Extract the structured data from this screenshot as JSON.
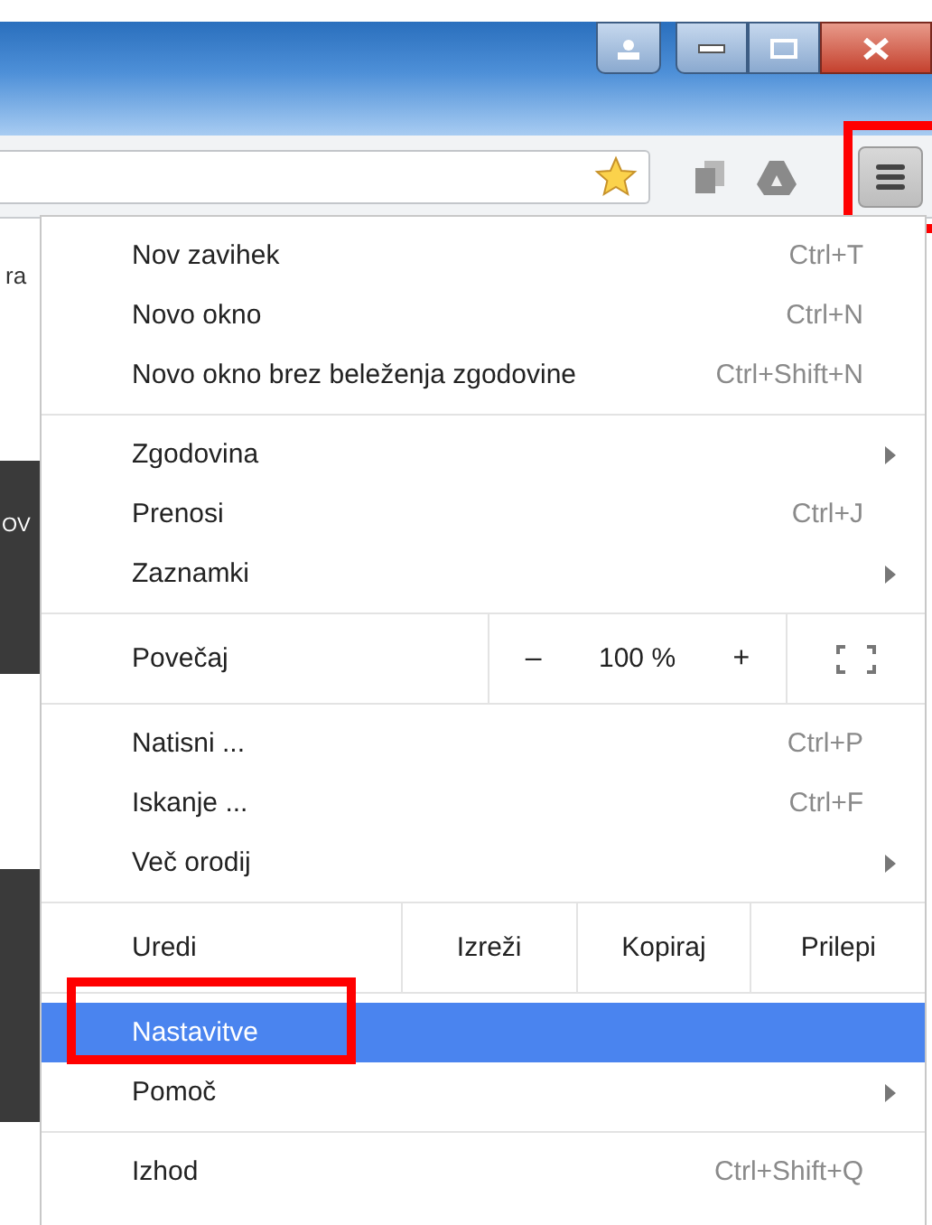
{
  "toolbar": {
    "menu_button": {
      "annotated": true
    }
  },
  "page_fragments": [
    {
      "text": "ra",
      "dark": false
    },
    {
      "text": "OV",
      "dark": true
    }
  ],
  "menu": {
    "groups": [
      {
        "items": [
          {
            "kind": "item",
            "label": "Nov zavihek",
            "shortcut": "Ctrl+T",
            "submenu": false,
            "selected": false,
            "annotated": false
          },
          {
            "kind": "item",
            "label": "Novo okno",
            "shortcut": "Ctrl+N",
            "submenu": false,
            "selected": false,
            "annotated": false
          },
          {
            "kind": "item",
            "label": "Novo okno brez beleženja zgodovine",
            "shortcut": "Ctrl+Shift+N",
            "submenu": false,
            "selected": false,
            "annotated": false
          }
        ]
      },
      {
        "items": [
          {
            "kind": "item",
            "label": "Zgodovina",
            "submenu": true,
            "selected": false,
            "annotated": false
          },
          {
            "kind": "item",
            "label": "Prenosi",
            "shortcut": "Ctrl+J",
            "submenu": false,
            "selected": false,
            "annotated": false
          },
          {
            "kind": "item",
            "label": "Zaznamki",
            "submenu": true,
            "selected": false,
            "annotated": false
          }
        ]
      },
      {
        "items": [
          {
            "kind": "zoom",
            "label": "Povečaj",
            "minus": "–",
            "value": "100 %",
            "plus": "+"
          }
        ]
      },
      {
        "items": [
          {
            "kind": "item",
            "label": "Natisni ...",
            "shortcut": "Ctrl+P",
            "submenu": false,
            "selected": false,
            "annotated": false
          },
          {
            "kind": "item",
            "label": "Iskanje ...",
            "shortcut": "Ctrl+F",
            "submenu": false,
            "selected": false,
            "annotated": false
          },
          {
            "kind": "item",
            "label": "Več orodij",
            "submenu": true,
            "selected": false,
            "annotated": false
          }
        ]
      },
      {
        "items": [
          {
            "kind": "edit",
            "label": "Uredi",
            "buttons": [
              "Izreži",
              "Kopiraj",
              "Prilepi"
            ]
          }
        ]
      },
      {
        "items": [
          {
            "kind": "item",
            "label": "Nastavitve",
            "submenu": false,
            "selected": true,
            "annotated": true
          },
          {
            "kind": "item",
            "label": "Pomoč",
            "submenu": true,
            "selected": false,
            "annotated": false
          }
        ]
      },
      {
        "items": [
          {
            "kind": "item",
            "label": "Izhod",
            "shortcut": "Ctrl+Shift+Q",
            "submenu": false,
            "selected": false,
            "annotated": false
          }
        ]
      }
    ]
  }
}
